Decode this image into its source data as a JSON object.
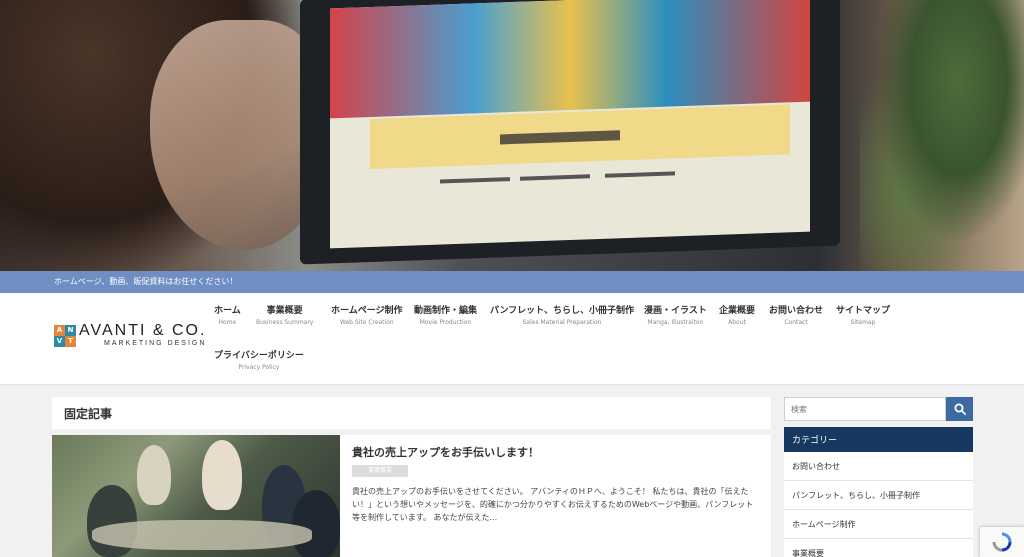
{
  "tagline": "ホームページ、動画、販促資料はお任せください！",
  "logo": {
    "mark": [
      "A",
      "N",
      "V",
      "T"
    ],
    "name": "AVANTI & CO.",
    "sub": "MARKETING DESIGN"
  },
  "nav": [
    {
      "ja": "ホーム",
      "en": "Home"
    },
    {
      "ja": "事業概要",
      "en": "Business Summary"
    },
    {
      "ja": "ホームページ制作",
      "en": "Web Site Creation"
    },
    {
      "ja": "動画制作・編集",
      "en": "Movie Production"
    },
    {
      "ja": "パンフレット、ちらし、小冊子制作",
      "en": "Sales Material Preparation"
    },
    {
      "ja": "漫画・イラスト",
      "en": "Manga, Illustraiton"
    },
    {
      "ja": "企業概要",
      "en": "About"
    },
    {
      "ja": "お問い合わせ",
      "en": "Contact"
    },
    {
      "ja": "サイトマップ",
      "en": "Sitemap"
    },
    {
      "ja": "プライバシーポリシー",
      "en": "Privacy Policy"
    }
  ],
  "main": {
    "section_title": "固定記事",
    "post": {
      "title": "貴社の売上アップをお手伝いします！",
      "category": "事業概要",
      "excerpt": "貴社の売上アップのお手伝いをさせてください。 アバンティのＨＰへ、ようこそ！ 私たちは、貴社の「伝えたい！」という想いやメッセージを、的確にかつ分かりやすくお伝えするためのWebページや動画、パンフレット等を制作しています。 あなたが伝えた..."
    }
  },
  "sidebar": {
    "search_placeholder": "検索",
    "category_heading": "カテゴリー",
    "categories": [
      "お問い合わせ",
      "パンフレット、ちらし、小冊子制作",
      "ホームページ制作",
      "事業概要"
    ]
  },
  "colors": {
    "tagline_bg": "#6f8ec3",
    "sidebar_heading_bg": "#17395f",
    "search_button_bg": "#3d6aa1"
  },
  "icons": {
    "search_button": "search-icon"
  }
}
